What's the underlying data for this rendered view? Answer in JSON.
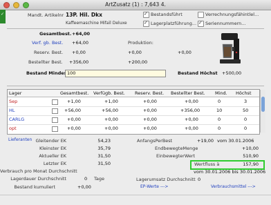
{
  "window": {
    "title": "ArtZusatz (1) : 7,643 4."
  },
  "header": {
    "article_label": "Mandt. Artikelnr",
    "article_no": "13P. Hil. Dkx",
    "article_desc": "Kaffeemaschine Mifaïl Deluxe",
    "cb_bestandsfuhrt": "Bestandsführt",
    "cb_lagerplatz": "Lagerplatzführung...",
    "cb_verrechnung": "Verrechnungsfähintlel...",
    "cb_seriennummern": "Seriennummern..."
  },
  "stock": {
    "gesamt_label": "Gesamtbest.",
    "gesamt_val": "+64,00",
    "verfugb_label": "Verf. gb. Best.",
    "verfugb_val": "+64,00",
    "produktion_label": "Produktion:",
    "reserv_label": "Reserv. Best.",
    "reserv_val1": "+0,00",
    "reserv_val2": "+0,00",
    "reserv_val3": "+0,00",
    "bestellt_label": "Bestellter Best.",
    "bestellt_val1": "+356,00",
    "bestellt_val2": "+200,00",
    "mindest_label": "Bestand Mindest",
    "mindest_val": "100",
    "hochst_label": "Bestand Höchst",
    "hochst_val": "+500,00"
  },
  "table": {
    "headers": [
      "Lager",
      "Gesamtbest.",
      "Verfügb. Best.",
      "Reserv. Best.",
      "Bestellter Best.",
      "Mind.",
      "Höchst"
    ],
    "rows": [
      {
        "lager": "Sep",
        "gesamt": "+1,00",
        "verfugb": "+1,00",
        "reserv": "+0,00",
        "bestellt": "+0,00",
        "mind": "0",
        "hochst": "3"
      },
      {
        "lager": "HL",
        "gesamt": "+56,00",
        "verfugb": "+56,00",
        "reserv": "+0,00",
        "bestellt": "+356,00",
        "mind": "10",
        "hochst": "50"
      },
      {
        "lager": "CARLG",
        "gesamt": "+0,00",
        "verfugb": "+0,00",
        "reserv": "+0,00",
        "bestellt": "+0,00",
        "mind": "0",
        "hochst": "0"
      },
      {
        "lager": "opt",
        "gesamt": "+0,00",
        "verfugb": "+0,00",
        "reserv": "+0,00",
        "bestellt": "+0,00",
        "mind": "0",
        "hochst": "0"
      }
    ]
  },
  "bottom": {
    "link_left": "Lieferanten",
    "l1_label": "Gleitender EK",
    "l1_val": "54,23",
    "l2_label": "Kleinster EK",
    "l2_val": "35,79",
    "l3_label": "Aktueller EK",
    "l3_val": "31,50",
    "l4_label": "Letzter EK",
    "l4_val": "31,50",
    "l5_label": "Verbrauch pro Monat Durchschnitt",
    "l5_val": "",
    "l6_label": "Lagerdauer Durchschnitt",
    "l6_val": "0",
    "l6_unit": "Tage",
    "l7_label": "Bestand kumuliert",
    "l7_val": "+0,00",
    "r1_label": "AnfangsPerBest",
    "r1_val": "+19,00",
    "r1_date": "vom 30.01.2006",
    "r2_label": "EndbewegteMenge",
    "r2_val": "+10,00",
    "r3_label": "EinbewegterWert",
    "r3_val": "510,90",
    "r4_label": "Wertfluss ä",
    "r4_val": "157,90",
    "r5_date": "vom 30.01.2006  bis  30.01.2006",
    "r6_label": "Lagerumsatz Durchschnitt",
    "r6_val": "0",
    "link_mid": "EP-Werte --->",
    "link_right": "Verbrauchsmittel --->"
  }
}
